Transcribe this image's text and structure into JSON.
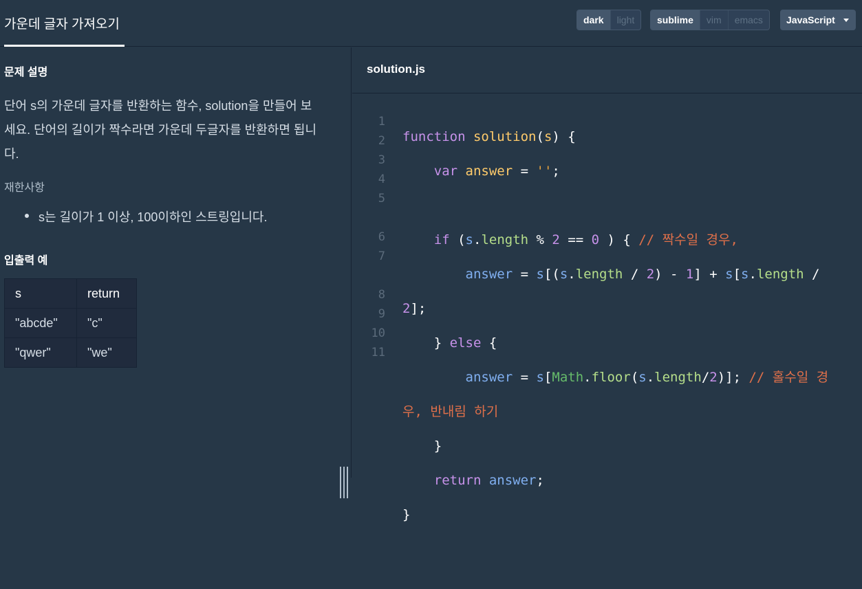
{
  "header": {
    "title": "가운데 글자 가져오기",
    "theme_options": [
      {
        "label": "dark",
        "active": true
      },
      {
        "label": "light",
        "active": false
      }
    ],
    "keymap_options": [
      {
        "label": "sublime",
        "active": true
      },
      {
        "label": "vim",
        "active": false
      },
      {
        "label": "emacs",
        "active": false
      }
    ],
    "language": "JavaScript"
  },
  "problem": {
    "section_title": "문제 설명",
    "description": "단어 s의 가운데 글자를 반환하는 함수, solution을 만들어 보세요. 단어의 길이가 짝수라면 가운데 두글자를 반환하면 됩니다.",
    "restrictions_title": "재한사항",
    "restrictions": [
      "s는 길이가 1 이상, 100이하인 스트링입니다."
    ],
    "io_title": "입출력 예",
    "io_table": {
      "headers": [
        "s",
        "return"
      ],
      "rows": [
        [
          "\"abcde\"",
          "\"c\""
        ],
        [
          "\"qwer\"",
          "\"we\""
        ]
      ]
    }
  },
  "editor": {
    "filename": "solution.js",
    "line_numbers": [
      "1",
      "2",
      "3",
      "4",
      "5",
      "",
      "6",
      "7",
      "",
      "8",
      "9",
      "10",
      "11"
    ]
  },
  "colors": {
    "background": "#263747",
    "keyword": "#c792ea",
    "function_name": "#ffcb6b",
    "variable": "#80aff0",
    "string": "#e8a33d",
    "comment": "#e0704a"
  }
}
